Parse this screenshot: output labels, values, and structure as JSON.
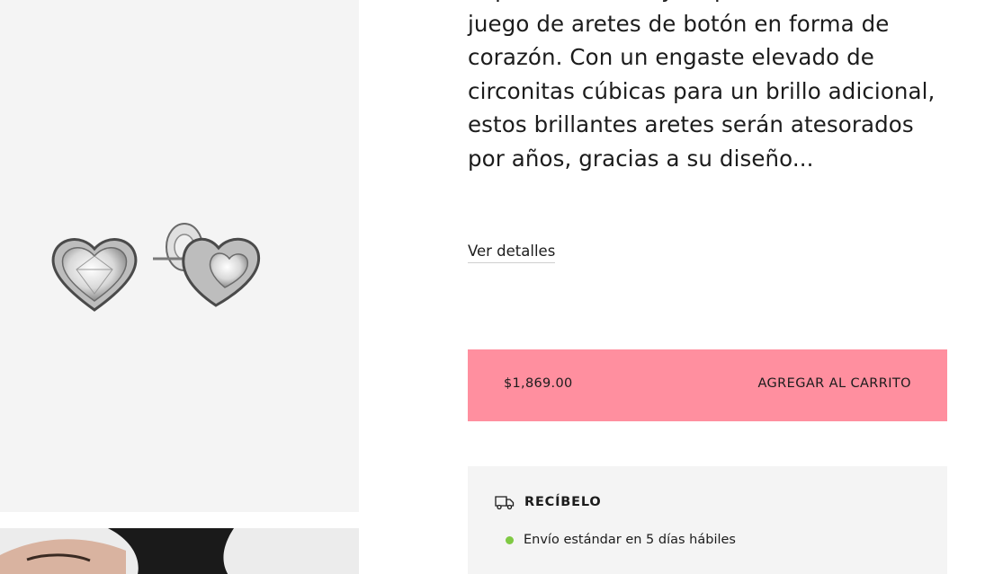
{
  "product": {
    "description": "Exprese su amor y su pasión con este juego de aretes de botón en forma de corazón. Con un engaste elevado de circonitas cúbicas para un brillo adicional, estos brillantes aretes serán atesorados por años, gracias a su diseño...",
    "details_link": "Ver detalles",
    "image_icon": "heart-stud-earrings"
  },
  "cart": {
    "price": "$1,869.00",
    "add_label": "AGREGAR AL CARRITO",
    "button_color": "#ff8f9f"
  },
  "delivery": {
    "title": "RECÍBELO",
    "icon": "truck-icon",
    "items": [
      {
        "label": "Envío estándar en 5 días hábiles",
        "status_color": "#7fc943"
      }
    ]
  }
}
